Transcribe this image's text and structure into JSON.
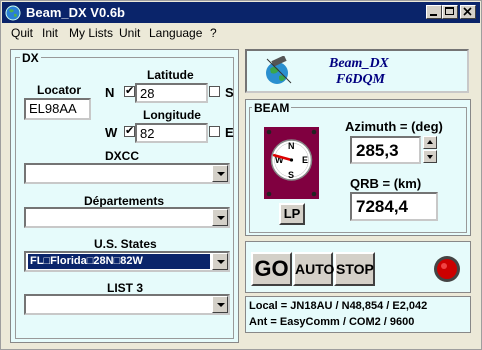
{
  "window": {
    "title": "Beam_DX  V0.6b"
  },
  "menu": {
    "items": [
      "Quit",
      "Init",
      "My Lists",
      "Unit",
      "Language",
      "?"
    ]
  },
  "dx": {
    "group_title": "DX",
    "locator_label": "Locator",
    "locator_value": "EL98AA",
    "latitude_label": "Latitude",
    "latitude_value": "28",
    "lat_north": "N",
    "lat_south": "S",
    "lat_check": "✔",
    "longitude_label": "Longitude",
    "longitude_value": "82",
    "lon_west": "W",
    "lon_east": "E",
    "lon_check": "✔",
    "dxcc_label": "DXCC",
    "departements_label": "Départements",
    "us_states_label": "U.S. States",
    "us_states_value": "FL□Florida□28N□82W",
    "list3_label": "LIST 3"
  },
  "brand": {
    "line1": "Beam_DX",
    "line2": "F6DQM"
  },
  "beam": {
    "group_title": "BEAM",
    "azimuth_label": "Azimuth = (deg)",
    "azimuth_value": "285,3",
    "qrb_label": "QRB = (km)",
    "qrb_value": "7284,4",
    "lp_label": "LP",
    "compass": {
      "n": "N",
      "s": "S",
      "e": "E",
      "w": "W",
      "bearing_deg": 285.3
    }
  },
  "controls": {
    "go": "GO",
    "auto": "AUTO",
    "stop": "STOP"
  },
  "status": {
    "local": "Local = JN18AU / N48,854 / E2,042",
    "ant": "Ant = EasyComm / COM2 / 9600"
  },
  "colors": {
    "title_bar": "#0a246a",
    "panel_bg": "#e6fbfb",
    "compass_body": "#800040",
    "brand_text": "#000080",
    "stop_light": "#cc0000"
  }
}
